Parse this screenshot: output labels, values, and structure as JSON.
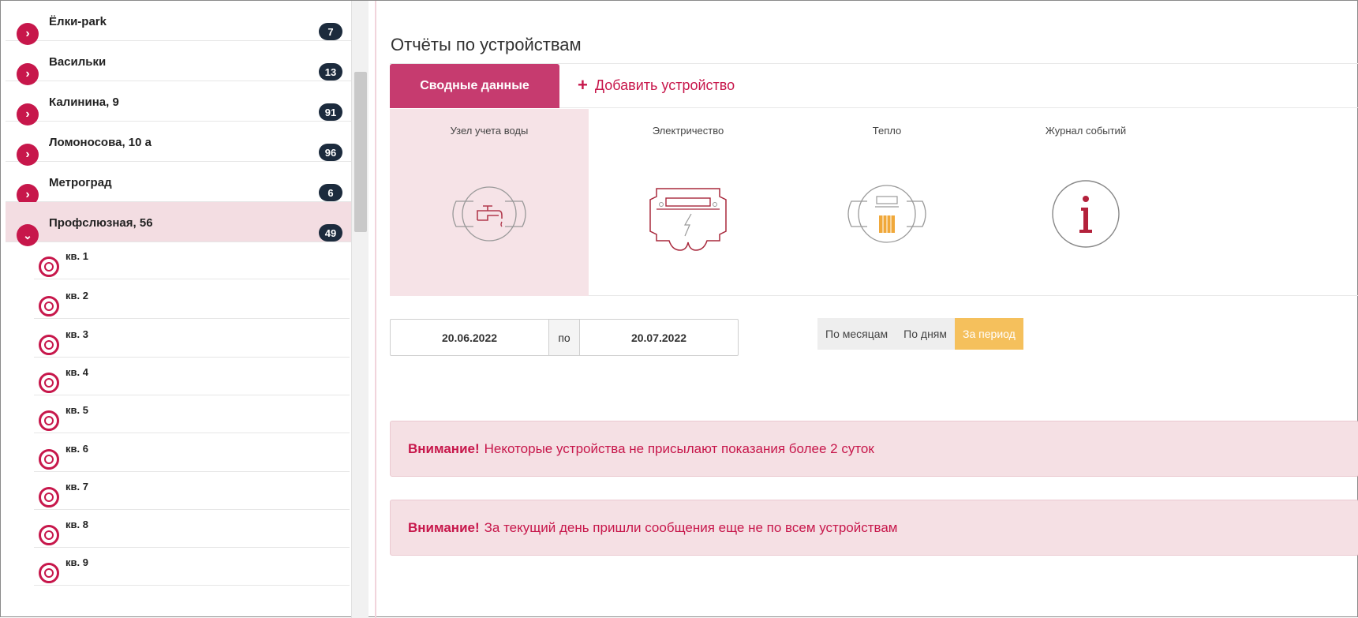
{
  "sidebar": {
    "groups": [
      {
        "label": "Ёлки-park",
        "count": "7",
        "icon": "chevron-right-icon"
      },
      {
        "label": "Васильки",
        "count": "13",
        "icon": "chevron-right-icon"
      },
      {
        "label": "Калинина, 9",
        "count": "91",
        "icon": "chevron-right-icon"
      },
      {
        "label": "Ломоносова, 10 а",
        "count": "96",
        "icon": "chevron-right-icon"
      },
      {
        "label": "Метроград",
        "count": "6",
        "icon": "chevron-right-icon"
      },
      {
        "label": "Профслюзная, 56",
        "count": "49",
        "icon": "chevron-down-icon"
      }
    ],
    "apartments": [
      "кв. 1",
      "кв. 2",
      "кв. 3",
      "кв. 4",
      "кв. 5",
      "кв. 6",
      "кв. 7",
      "кв. 8",
      "кв. 9"
    ]
  },
  "main": {
    "title": "Отчёты по устройствам",
    "tab_summary": "Сводные данные",
    "tab_add_plus": "+",
    "tab_add": "Добавить устройство",
    "devices": [
      {
        "label": "Узел учета воды",
        "icon": "water-meter-icon"
      },
      {
        "label": "Электричество",
        "icon": "electricity-meter-icon"
      },
      {
        "label": "Тепло",
        "icon": "heat-meter-icon"
      },
      {
        "label": "Журнал событий",
        "icon": "info-icon"
      }
    ],
    "date_from": "20.06.2022",
    "date_sep": "по",
    "date_to": "20.07.2022",
    "period": {
      "months": "По месяцам",
      "days": "По дням",
      "range": "За период"
    },
    "alerts": [
      {
        "strong": "Внимание!",
        "text": "Некоторые устройства не присылают показания более 2 суток"
      },
      {
        "strong": "Внимание!",
        "text": "За текущий день пришли сообщения еще не по всем устройствам"
      }
    ]
  },
  "colors": {
    "accent": "#c7174b",
    "tab_active": "#c63b6f",
    "badge": "#1c2b3d",
    "period_active": "#f5c05c",
    "alert_bg": "#f5e0e4"
  }
}
